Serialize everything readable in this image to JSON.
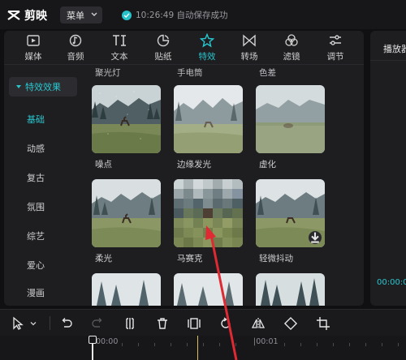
{
  "app": {
    "name": "剪映",
    "menu_label": "菜单",
    "save_status": "10:26:49 自动保存成功"
  },
  "tabs": [
    {
      "label": "媒体",
      "icon": "media-icon"
    },
    {
      "label": "音频",
      "icon": "audio-icon"
    },
    {
      "label": "文本",
      "icon": "text-icon"
    },
    {
      "label": "贴纸",
      "icon": "sticker-icon"
    },
    {
      "label": "特效",
      "icon": "effects-icon",
      "active": true
    },
    {
      "label": "转场",
      "icon": "transition-icon"
    },
    {
      "label": "滤镜",
      "icon": "filter-icon"
    },
    {
      "label": "调节",
      "icon": "adjust-icon"
    }
  ],
  "sidebar": {
    "header": "特效效果",
    "items": [
      "基础",
      "动感",
      "复古",
      "氛围",
      "综艺",
      "爱心",
      "漫画"
    ],
    "active_index": 0
  },
  "effects": {
    "top_labels": [
      "聚光灯",
      "手电筒",
      "色差"
    ],
    "items": [
      {
        "label": "噪点"
      },
      {
        "label": "边缘发光"
      },
      {
        "label": "虚化"
      },
      {
        "label": "柔光"
      },
      {
        "label": "马赛克"
      },
      {
        "label": "轻微抖动",
        "download": true
      }
    ]
  },
  "player": {
    "title": "播放器",
    "timecode": "00:00:0"
  },
  "timeline": {
    "ruler": [
      "00:00",
      "|00:01"
    ]
  },
  "colors": {
    "accent": "#29c6cf",
    "annotation": "#e02a33"
  }
}
